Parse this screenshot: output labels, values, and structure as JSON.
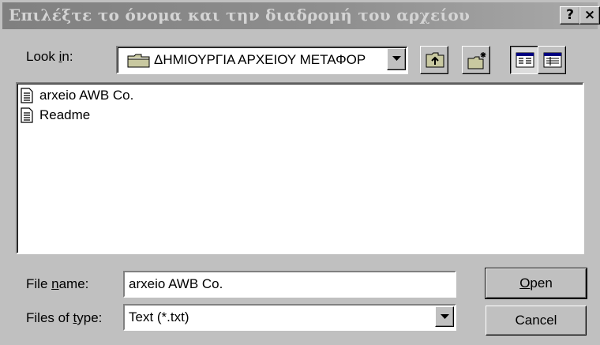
{
  "window": {
    "title": "Επιλέξτε το όνομα και την διαδρομή του αρχείου",
    "help_glyph": "?",
    "close_glyph": "×"
  },
  "lookin": {
    "label_pre": "Look ",
    "label_u": "i",
    "label_post": "n:",
    "value": "ΔΗΜΙΟΥΡΓΙΑ ΑΡΧΕΙΟΥ ΜΕΤΑΦΟΡ",
    "icon": "folder-icon"
  },
  "toolbar": {
    "buttons": [
      {
        "name": "up-one-level",
        "icon": "folder-up-icon"
      },
      {
        "name": "create-new-folder",
        "icon": "new-folder-icon"
      },
      {
        "name": "list-view",
        "icon": "list-view-icon"
      },
      {
        "name": "details-view",
        "icon": "details-view-icon"
      }
    ]
  },
  "files": [
    {
      "name": "arxeio AWB Co.",
      "icon": "text-document-icon"
    },
    {
      "name": "Readme",
      "icon": "text-document-icon"
    }
  ],
  "filename": {
    "label_pre": "File ",
    "label_u": "n",
    "label_post": "ame:",
    "value": "arxeio AWB Co."
  },
  "filetype": {
    "label_pre": "Files of ",
    "label_u": "t",
    "label_post": "ype:",
    "value": "Text (*.txt)"
  },
  "buttons": {
    "open_u": "O",
    "open_rest": "pen",
    "cancel": "Cancel"
  },
  "colors": {
    "face": "#c0c0c0",
    "titlebar_inactive": "#808080",
    "title_text": "#d4d4d4"
  }
}
